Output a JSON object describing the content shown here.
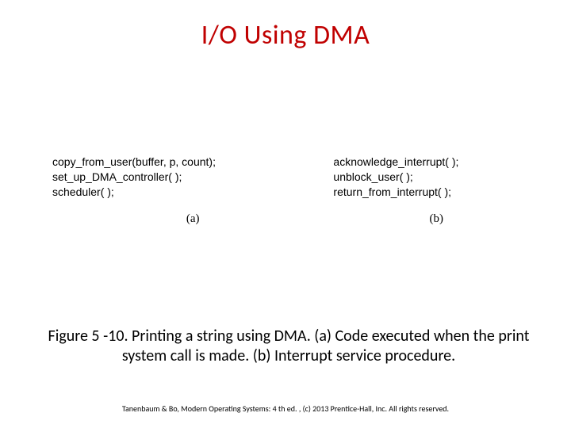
{
  "title": "I/O Using DMA",
  "code": {
    "left": {
      "lines": [
        "copy_from_user(buffer, p, count);",
        "set_up_DMA_controller( );",
        "scheduler( );"
      ],
      "label": "(a)"
    },
    "right": {
      "lines": [
        "acknowledge_interrupt( );",
        "unblock_user( );",
        "return_from_interrupt( );"
      ],
      "label": "(b)"
    }
  },
  "caption": "Figure 5 -10. Printing a string using DMA. (a) Code executed when the print system call is made. (b) Interrupt service procedure.",
  "footer": "Tanenbaum & Bo, Modern Operating Systems: 4 th ed. , (c) 2013 Prentice-Hall, Inc. All rights reserved."
}
